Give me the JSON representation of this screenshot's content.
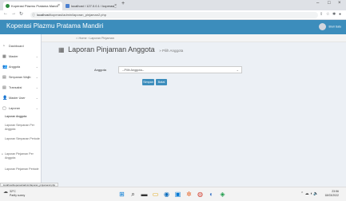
{
  "browser": {
    "tabs": [
      {
        "label": "Koperasi Plazmu Pratama Mandi",
        "active": true
      },
      {
        "label": "localhost / 127.0.0.1 / koperasi_",
        "active": false
      }
    ],
    "new_tab_label": "+",
    "url_host": "localhost",
    "url_path": "/koperasi/admin/laporan_pinjaman2.php"
  },
  "app": {
    "brand": "Koperasi Plazmu Pratama Mandiri",
    "user_label": "Bruri Satu"
  },
  "sidebar": {
    "items": [
      {
        "label": "Dashboard",
        "icon": "dashboard-icon",
        "glyph": "◔"
      },
      {
        "label": "Master",
        "icon": "master-icon",
        "glyph": "▦"
      },
      {
        "label": "Anggota",
        "icon": "users-icon",
        "glyph": "👥"
      },
      {
        "label": "Simpanan Wajib",
        "icon": "savings-icon",
        "glyph": "▤"
      },
      {
        "label": "Transaksi",
        "icon": "transaction-icon",
        "glyph": "▤"
      },
      {
        "label": "Master User",
        "icon": "user-icon",
        "glyph": "👤"
      },
      {
        "label": "Laporan",
        "icon": "report-icon",
        "glyph": "▢"
      }
    ],
    "subitems": [
      "Laporan Anggota",
      "Laporan Simpanan Per Anggota",
      "Laporan Simpanan Periode",
      "Laporan Pinjaman Per Anggota",
      "Laporan Pinjaman Periode"
    ]
  },
  "breadcrumb": {
    "home": "Home",
    "current": "Laporan Pinjaman"
  },
  "page": {
    "title": "Laporan Pinjaman Anggota",
    "subtitle": "» Pilih Anggota"
  },
  "form": {
    "label": "Anggota",
    "select_value": "--Pilih Anggota--",
    "submit_label": "Simpan",
    "reset_label": "Batal"
  },
  "status_url": "localhost/koperasi/admin/laporan_pinjaman2.php",
  "taskbar": {
    "weather_temp": "32°C",
    "weather_desc": "Partly sunny",
    "time": "23:56",
    "date": "18/03/2022"
  }
}
